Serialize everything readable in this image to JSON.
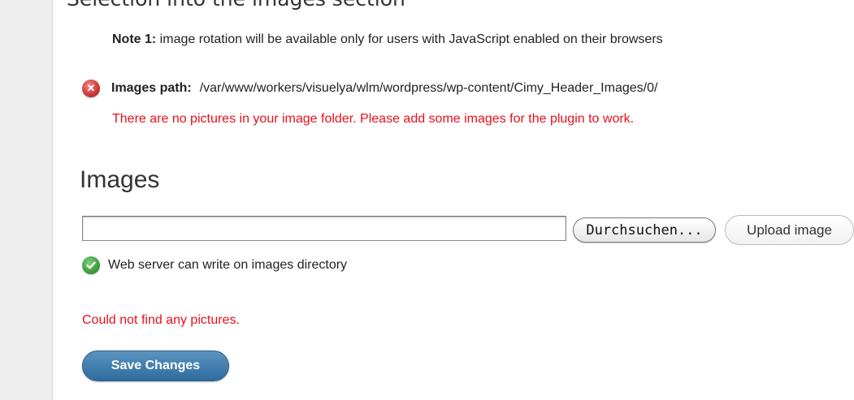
{
  "header": {
    "caption": "Selection into the images section"
  },
  "note": {
    "label": "Note 1:",
    "text": " image rotation will be available only for users with JavaScript enabled on their browsers"
  },
  "images_path": {
    "status_icon": "error-icon",
    "label": "Images path:",
    "value": "/var/www/workers/visuelya/wlm/wordpress/wp-content/Cimy_Header_Images/0/",
    "error": "There are no pictures in your image folder. Please add some images for the plugin to work."
  },
  "images_section": {
    "title": "Images",
    "file_input_value": "",
    "browse_label": "Durchsuchen...",
    "upload_label": "Upload image",
    "write_status_icon": "check-icon",
    "write_status": "Web server can write on images directory",
    "no_pictures": "Could not find any pictures."
  },
  "actions": {
    "save_label": "Save Changes"
  },
  "colors": {
    "error": "#e8101a",
    "primary_button": "#2f6c9e",
    "sidebar": "#eeeeee"
  }
}
